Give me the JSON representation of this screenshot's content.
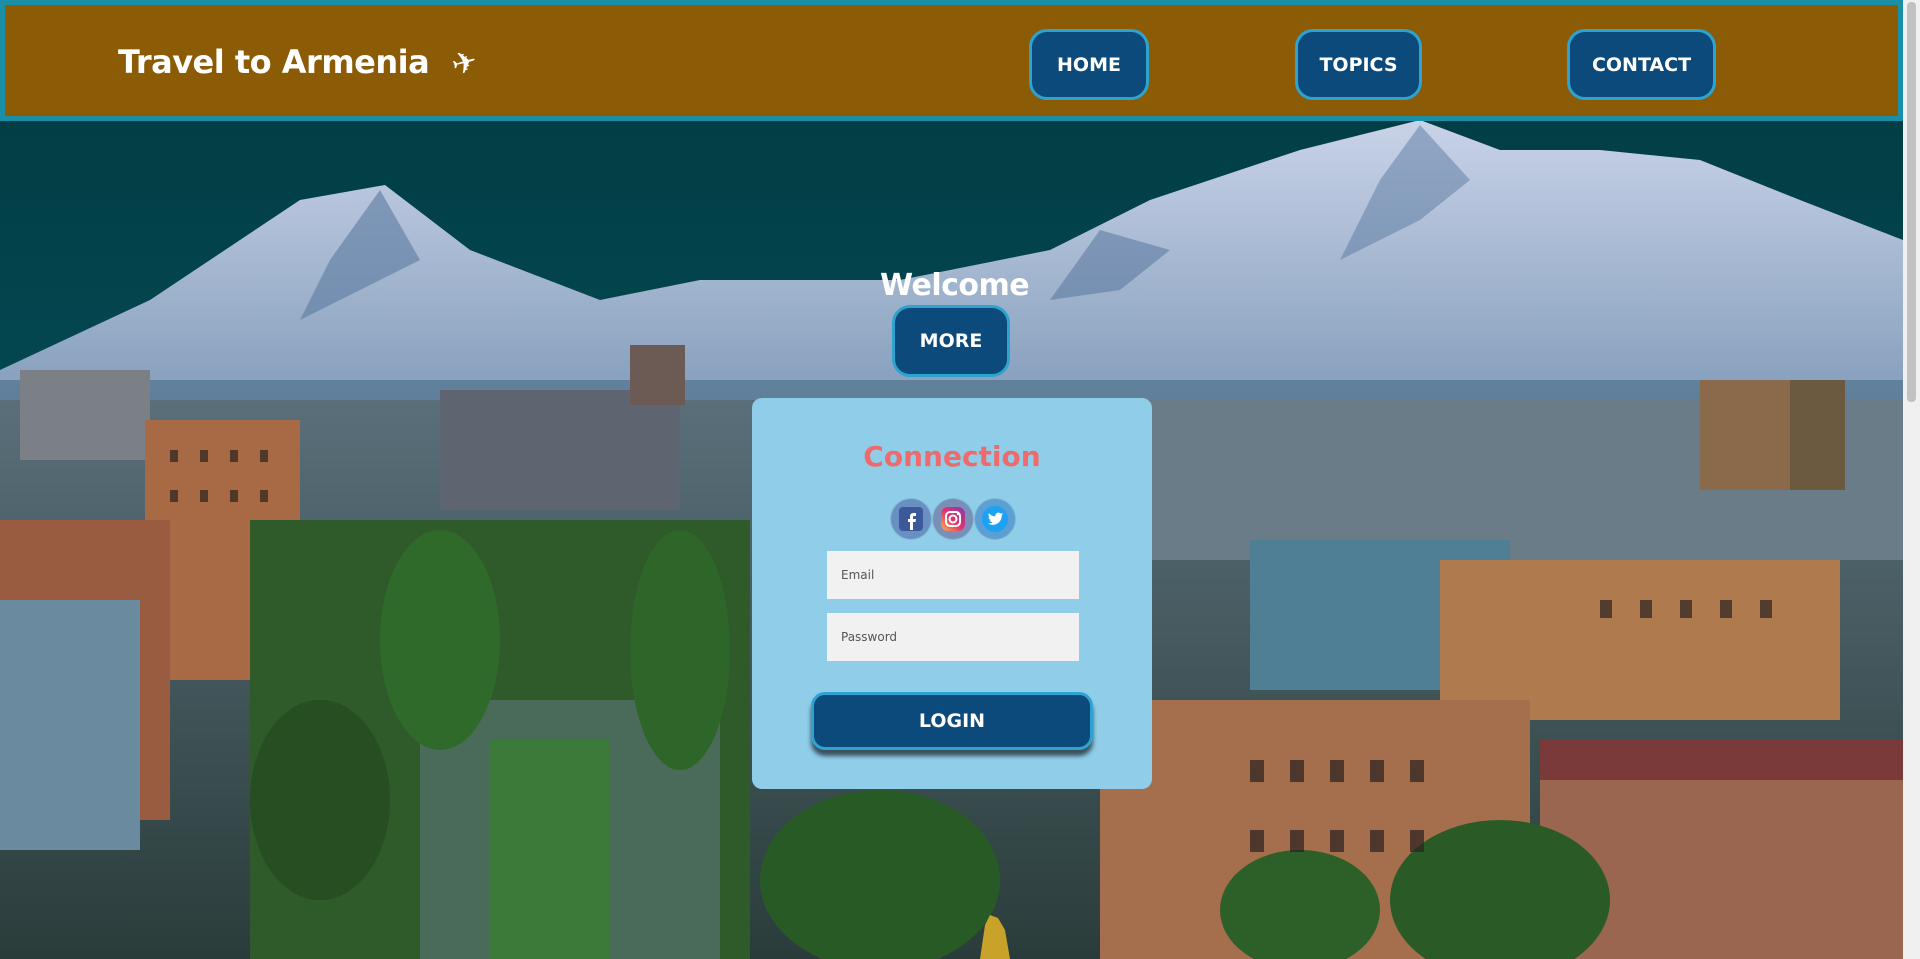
{
  "header": {
    "brand": "Travel to Armenia",
    "brand_icon": "airplane-icon",
    "nav": [
      {
        "label": "HOME"
      },
      {
        "label": "TOPICS"
      },
      {
        "label": "CONTACT"
      }
    ]
  },
  "hero": {
    "welcome": "Welcome",
    "more_label": "MORE"
  },
  "login": {
    "title": "Connection",
    "socials": [
      "facebook-icon",
      "instagram-icon",
      "twitter-icon"
    ],
    "email_placeholder": "Email",
    "password_placeholder": "Password",
    "login_label": "LOGIN"
  },
  "colors": {
    "header_bg": "#8c5b06",
    "header_border": "#1a8fa6",
    "button_bg": "#0b4a7a",
    "button_border": "#2fa3d0",
    "card_bg": "#8fcde9",
    "title_color": "#ef6a6a"
  }
}
